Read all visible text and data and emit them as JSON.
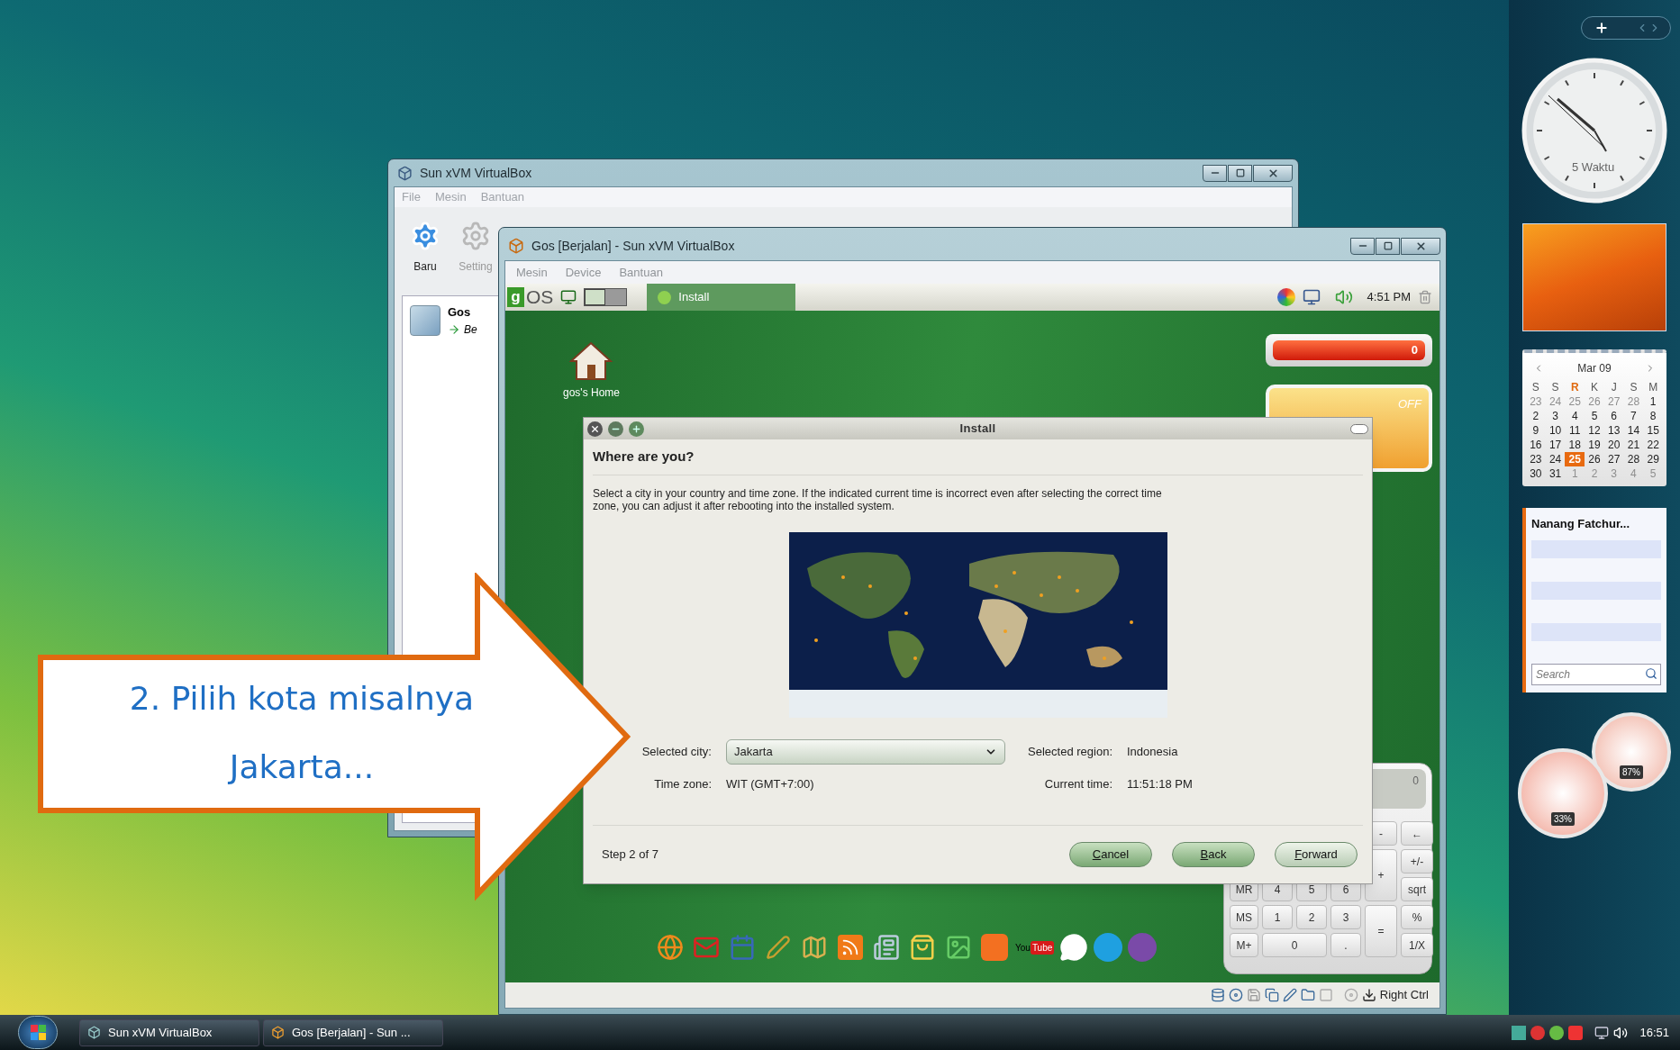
{
  "manager_window": {
    "title": "Sun xVM VirtualBox",
    "menu": [
      "File",
      "Mesin",
      "Bantuan"
    ],
    "toolbar": [
      "Baru",
      "Setting"
    ],
    "vm_list": [
      {
        "name": "Gos",
        "status": "Be"
      }
    ]
  },
  "vm_window": {
    "title": "Gos [Berjalan] - Sun xVM VirtualBox",
    "menu": [
      "Mesin",
      "Device",
      "Bantuan"
    ],
    "status_bar": {
      "host_key": "Right Ctrl"
    }
  },
  "guest": {
    "panel": {
      "logo_letter": "g",
      "logo_text": "OS",
      "task": "Install",
      "clock": "4:51 PM"
    },
    "desktop_icon": "gos's Home",
    "counter_widget": "0",
    "toggle_widget": "OFF",
    "calculator": {
      "display": "0",
      "keys": [
        "-",
        "←",
        "+",
        "+/-",
        "MR",
        "4",
        "5",
        "6",
        "sqrt",
        "MS",
        "1",
        "2",
        "3",
        "=",
        "%",
        "M+",
        "0",
        ".",
        "1/X"
      ]
    },
    "dock": {
      "video_logo": [
        "You",
        "Tube"
      ]
    }
  },
  "install_dialog": {
    "title": "Install",
    "heading": "Where are you?",
    "description": "Select a city in your country and time zone. If the indicated current time is incorrect even after selecting the correct time zone, you can adjust it after rebooting into the installed system.",
    "fields": [
      {
        "label": "Selected city:",
        "value": "Jakarta",
        "kind": "combo"
      },
      {
        "label": "Selected region:",
        "value": "Indonesia",
        "kind": "text"
      },
      {
        "label": "Time zone:",
        "value": "WIT (GMT+7:00)",
        "kind": "text"
      },
      {
        "label": "Current time:",
        "value": "11:51:18 PM",
        "kind": "text"
      }
    ],
    "step": "Step 2 of 7",
    "buttons": [
      "Cancel",
      "Back",
      "Forward"
    ]
  },
  "callout": {
    "lines": [
      "2. Pilih kota misalnya",
      "Jakarta..."
    ]
  },
  "sidebar": {
    "clock_label": "5 Waktu",
    "calendar": {
      "month": "Mar 09",
      "weekdays": [
        {
          "label": "S",
          "highlighted": false
        },
        {
          "label": "S",
          "highlighted": false
        },
        {
          "label": "R",
          "highlighted": true
        },
        {
          "label": "K",
          "highlighted": false
        },
        {
          "label": "J",
          "highlighted": false
        },
        {
          "label": "S",
          "highlighted": false
        },
        {
          "label": "M",
          "highlighted": false
        }
      ],
      "days": [
        {
          "label": "23",
          "muted": true,
          "selected": false
        },
        {
          "label": "24",
          "muted": true,
          "selected": false
        },
        {
          "label": "25",
          "muted": true,
          "selected": false
        },
        {
          "label": "26",
          "muted": true,
          "selected": false
        },
        {
          "label": "27",
          "muted": true,
          "selected": false
        },
        {
          "label": "28",
          "muted": true,
          "selected": false
        },
        {
          "label": "1",
          "muted": false,
          "selected": false
        },
        {
          "label": "2",
          "muted": false,
          "selected": false
        },
        {
          "label": "3",
          "muted": false,
          "selected": false
        },
        {
          "label": "4",
          "muted": false,
          "selected": false
        },
        {
          "label": "5",
          "muted": false,
          "selected": false
        },
        {
          "label": "6",
          "muted": false,
          "selected": false
        },
        {
          "label": "7",
          "muted": false,
          "selected": false
        },
        {
          "label": "8",
          "muted": false,
          "selected": false
        },
        {
          "label": "9",
          "muted": false,
          "selected": false
        },
        {
          "label": "10",
          "muted": false,
          "selected": false
        },
        {
          "label": "11",
          "muted": false,
          "selected": false
        },
        {
          "label": "12",
          "muted": false,
          "selected": false
        },
        {
          "label": "13",
          "muted": false,
          "selected": false
        },
        {
          "label": "14",
          "muted": false,
          "selected": false
        },
        {
          "label": "15",
          "muted": false,
          "selected": false
        },
        {
          "label": "16",
          "muted": false,
          "selected": false
        },
        {
          "label": "17",
          "muted": false,
          "selected": false
        },
        {
          "label": "18",
          "muted": false,
          "selected": false
        },
        {
          "label": "19",
          "muted": false,
          "selected": false
        },
        {
          "label": "20",
          "muted": false,
          "selected": false
        },
        {
          "label": "21",
          "muted": false,
          "selected": false
        },
        {
          "label": "22",
          "muted": false,
          "selected": false
        },
        {
          "label": "23",
          "muted": false,
          "selected": false
        },
        {
          "label": "24",
          "muted": false,
          "selected": false
        },
        {
          "label": "25",
          "muted": false,
          "selected": true
        },
        {
          "label": "26",
          "muted": false,
          "selected": false
        },
        {
          "label": "27",
          "muted": false,
          "selected": false
        },
        {
          "label": "28",
          "muted": false,
          "selected": false
        },
        {
          "label": "29",
          "muted": false,
          "selected": false
        },
        {
          "label": "30",
          "muted": false,
          "selected": false
        },
        {
          "label": "31",
          "muted": false,
          "selected": false
        },
        {
          "label": "1",
          "muted": true,
          "selected": false
        },
        {
          "label": "2",
          "muted": true,
          "selected": false
        },
        {
          "label": "3",
          "muted": true,
          "selected": false
        },
        {
          "label": "4",
          "muted": true,
          "selected": false
        },
        {
          "label": "5",
          "muted": true,
          "selected": false
        }
      ]
    },
    "contacts": {
      "title": "Nanang Fatchur...",
      "search_placeholder": "Search"
    },
    "meters": [
      "33%",
      "87%"
    ]
  },
  "taskbar": {
    "buttons": [
      "Sun xVM VirtualBox",
      "Gos [Berjalan] - Sun ..."
    ],
    "clock": "16:51"
  }
}
